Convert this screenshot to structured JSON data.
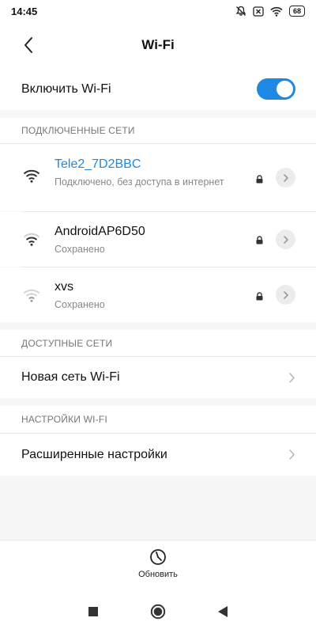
{
  "status_bar": {
    "time": "14:45",
    "battery": "68",
    "icons": [
      "bell-off-icon",
      "close-box-icon",
      "wifi-icon",
      "battery-icon"
    ]
  },
  "header": {
    "title": "Wi-Fi",
    "back_icon": "chevron-left-icon"
  },
  "wifi_toggle": {
    "label": "Включить Wi-Fi",
    "enabled": true
  },
  "connected_networks": {
    "header": "ПОДКЛЮЧЕННЫЕ СЕТИ",
    "items": [
      {
        "name": "Tele2_7D2BBC",
        "status": "Подключено, без доступа в интернет",
        "active": true,
        "signal_icon": "wifi-full-icon",
        "secured": true
      },
      {
        "name": "AndroidAP6D50",
        "status": "Сохранено",
        "active": false,
        "signal_icon": "wifi-medium-icon",
        "secured": true
      },
      {
        "name": "xvs",
        "status": "Сохранено",
        "active": false,
        "signal_icon": "wifi-weak-icon",
        "secured": true
      }
    ]
  },
  "available_networks": {
    "header": "ДОСТУПНЫЕ СЕТИ",
    "new_network_label": "Новая сеть Wi-Fi"
  },
  "wifi_settings": {
    "header": "НАСТРОЙКИ WI-FI",
    "advanced_label": "Расширенные настройки"
  },
  "bottom_bar": {
    "refresh_label": "Обновить"
  },
  "colors": {
    "accent": "#1e88e5",
    "background": "#f7f7f7"
  }
}
